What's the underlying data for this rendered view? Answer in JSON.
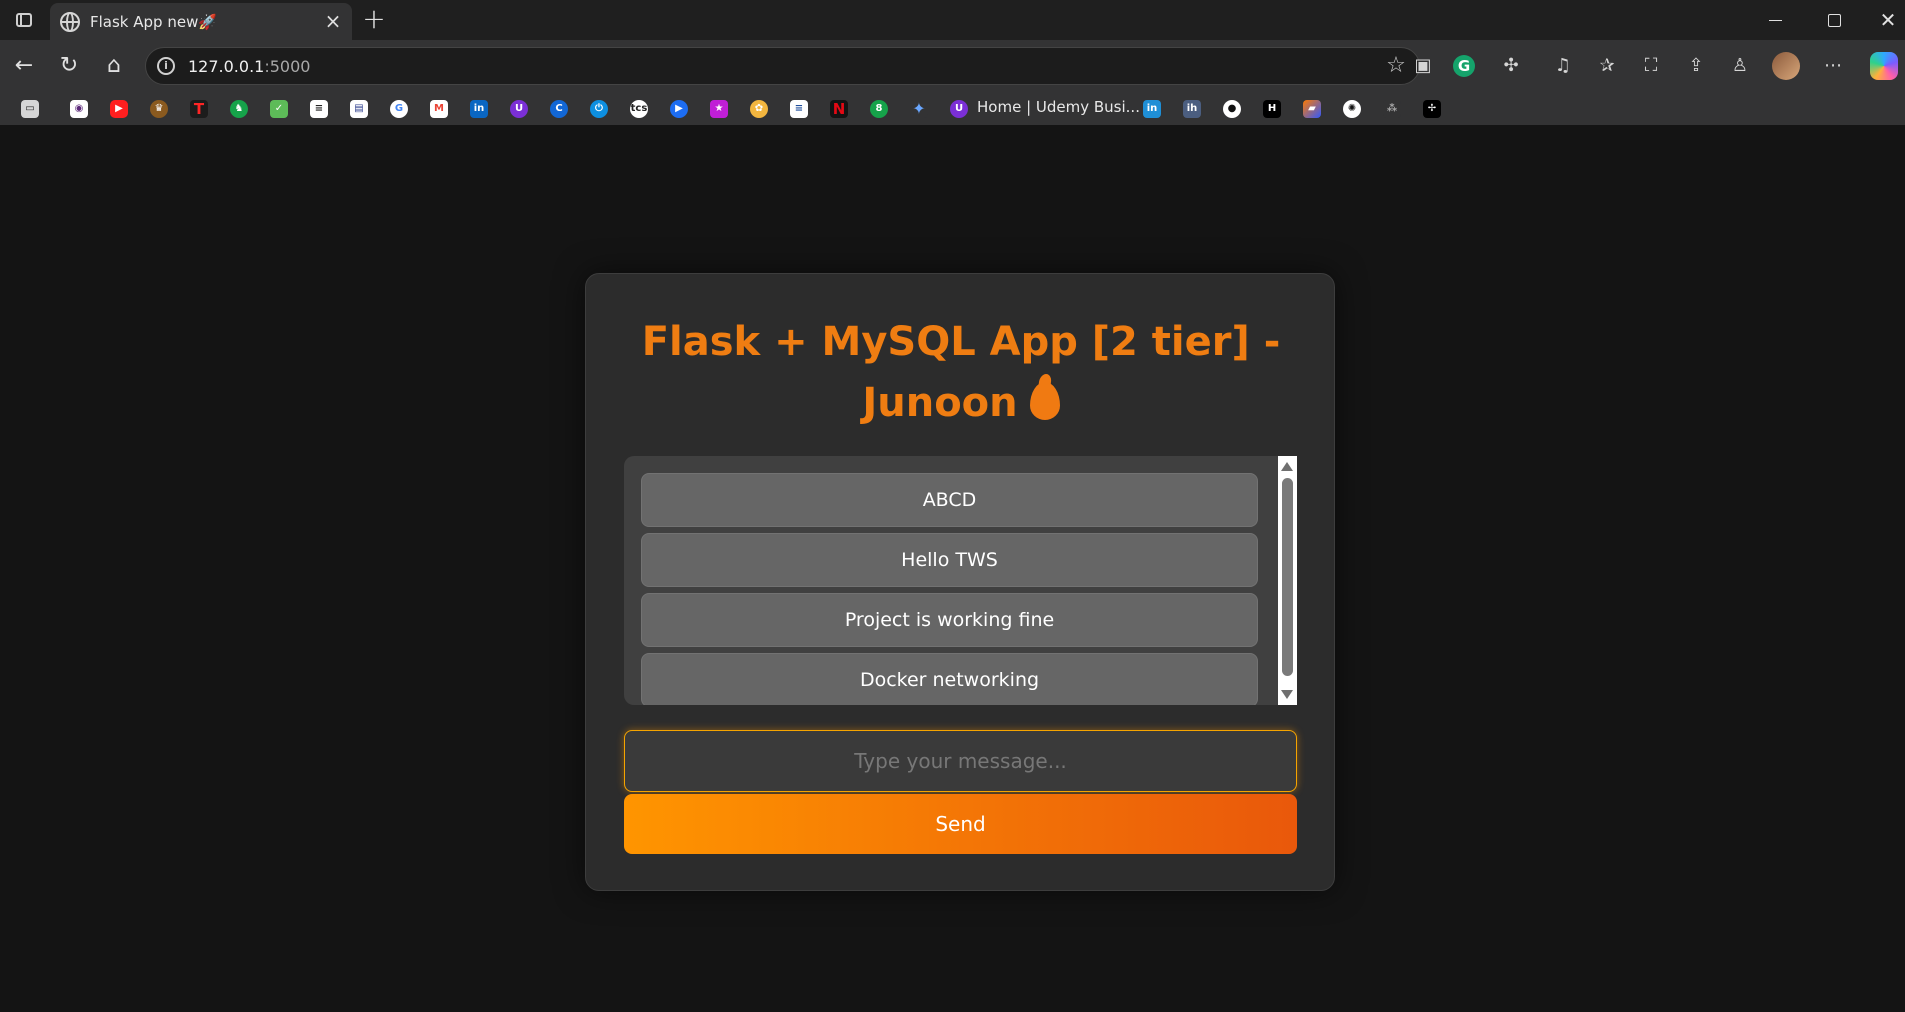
{
  "browser": {
    "tab_title": "Flask App new🚀",
    "tab_close": "×",
    "new_tab": "+",
    "url_host": "127.0.0.1",
    "url_port": ":5000",
    "bookmark_label": "Home | Udemy Busi...",
    "window_close": "✕"
  },
  "app": {
    "title": "Flask + MySQL App [2 tier] - Junoon",
    "messages": [
      "ABCD",
      "Hello TWS",
      "Project is working fine",
      "Docker networking"
    ],
    "input_placeholder": "Type your message...",
    "send_label": "Send"
  },
  "colors": {
    "accent": "#ef7d12",
    "send_start": "#ff9500",
    "send_end": "#e9580b",
    "card": "#2c2c2c"
  }
}
